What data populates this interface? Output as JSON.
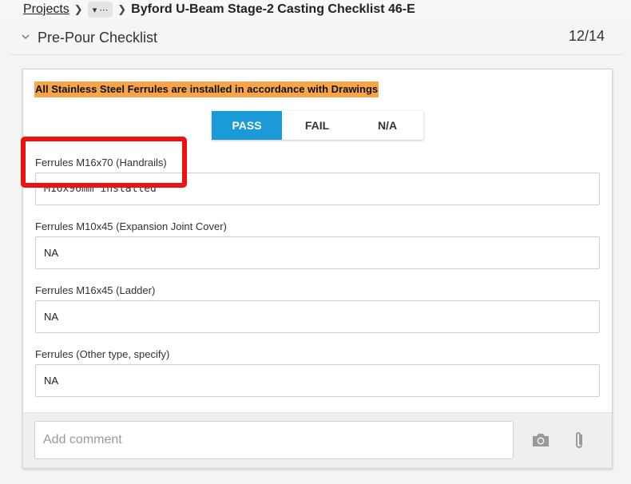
{
  "breadcrumb": {
    "root": "Projects",
    "more": "⋯",
    "current": "Byford U-Beam Stage-2 Casting Checklist 46-E"
  },
  "section": {
    "title": "Pre-Pour Checklist",
    "count": "12/14"
  },
  "question": {
    "text": "All Stainless Steel Ferrules are installed in accordance with Drawings",
    "options": [
      "PASS",
      "FAIL",
      "N/A"
    ],
    "selected": "PASS"
  },
  "fields": [
    {
      "label": "Ferrules M16x70 (Handrails)",
      "value": "M16x96mm installed"
    },
    {
      "label": "Ferrules M10x45 (Expansion Joint Cover)",
      "value": "NA"
    },
    {
      "label": "Ferrules M16x45 (Ladder)",
      "value": "NA"
    },
    {
      "label": "Ferrules (Other type, specify)",
      "value": "NA"
    }
  ],
  "comment": {
    "placeholder": "Add comment"
  },
  "icons": {
    "camera": "camera-icon",
    "attach": "paperclip-icon"
  },
  "colors": {
    "accent": "#1a9bd7",
    "highlight_bg": "#f7a54a",
    "annotation": "#ee1111"
  }
}
